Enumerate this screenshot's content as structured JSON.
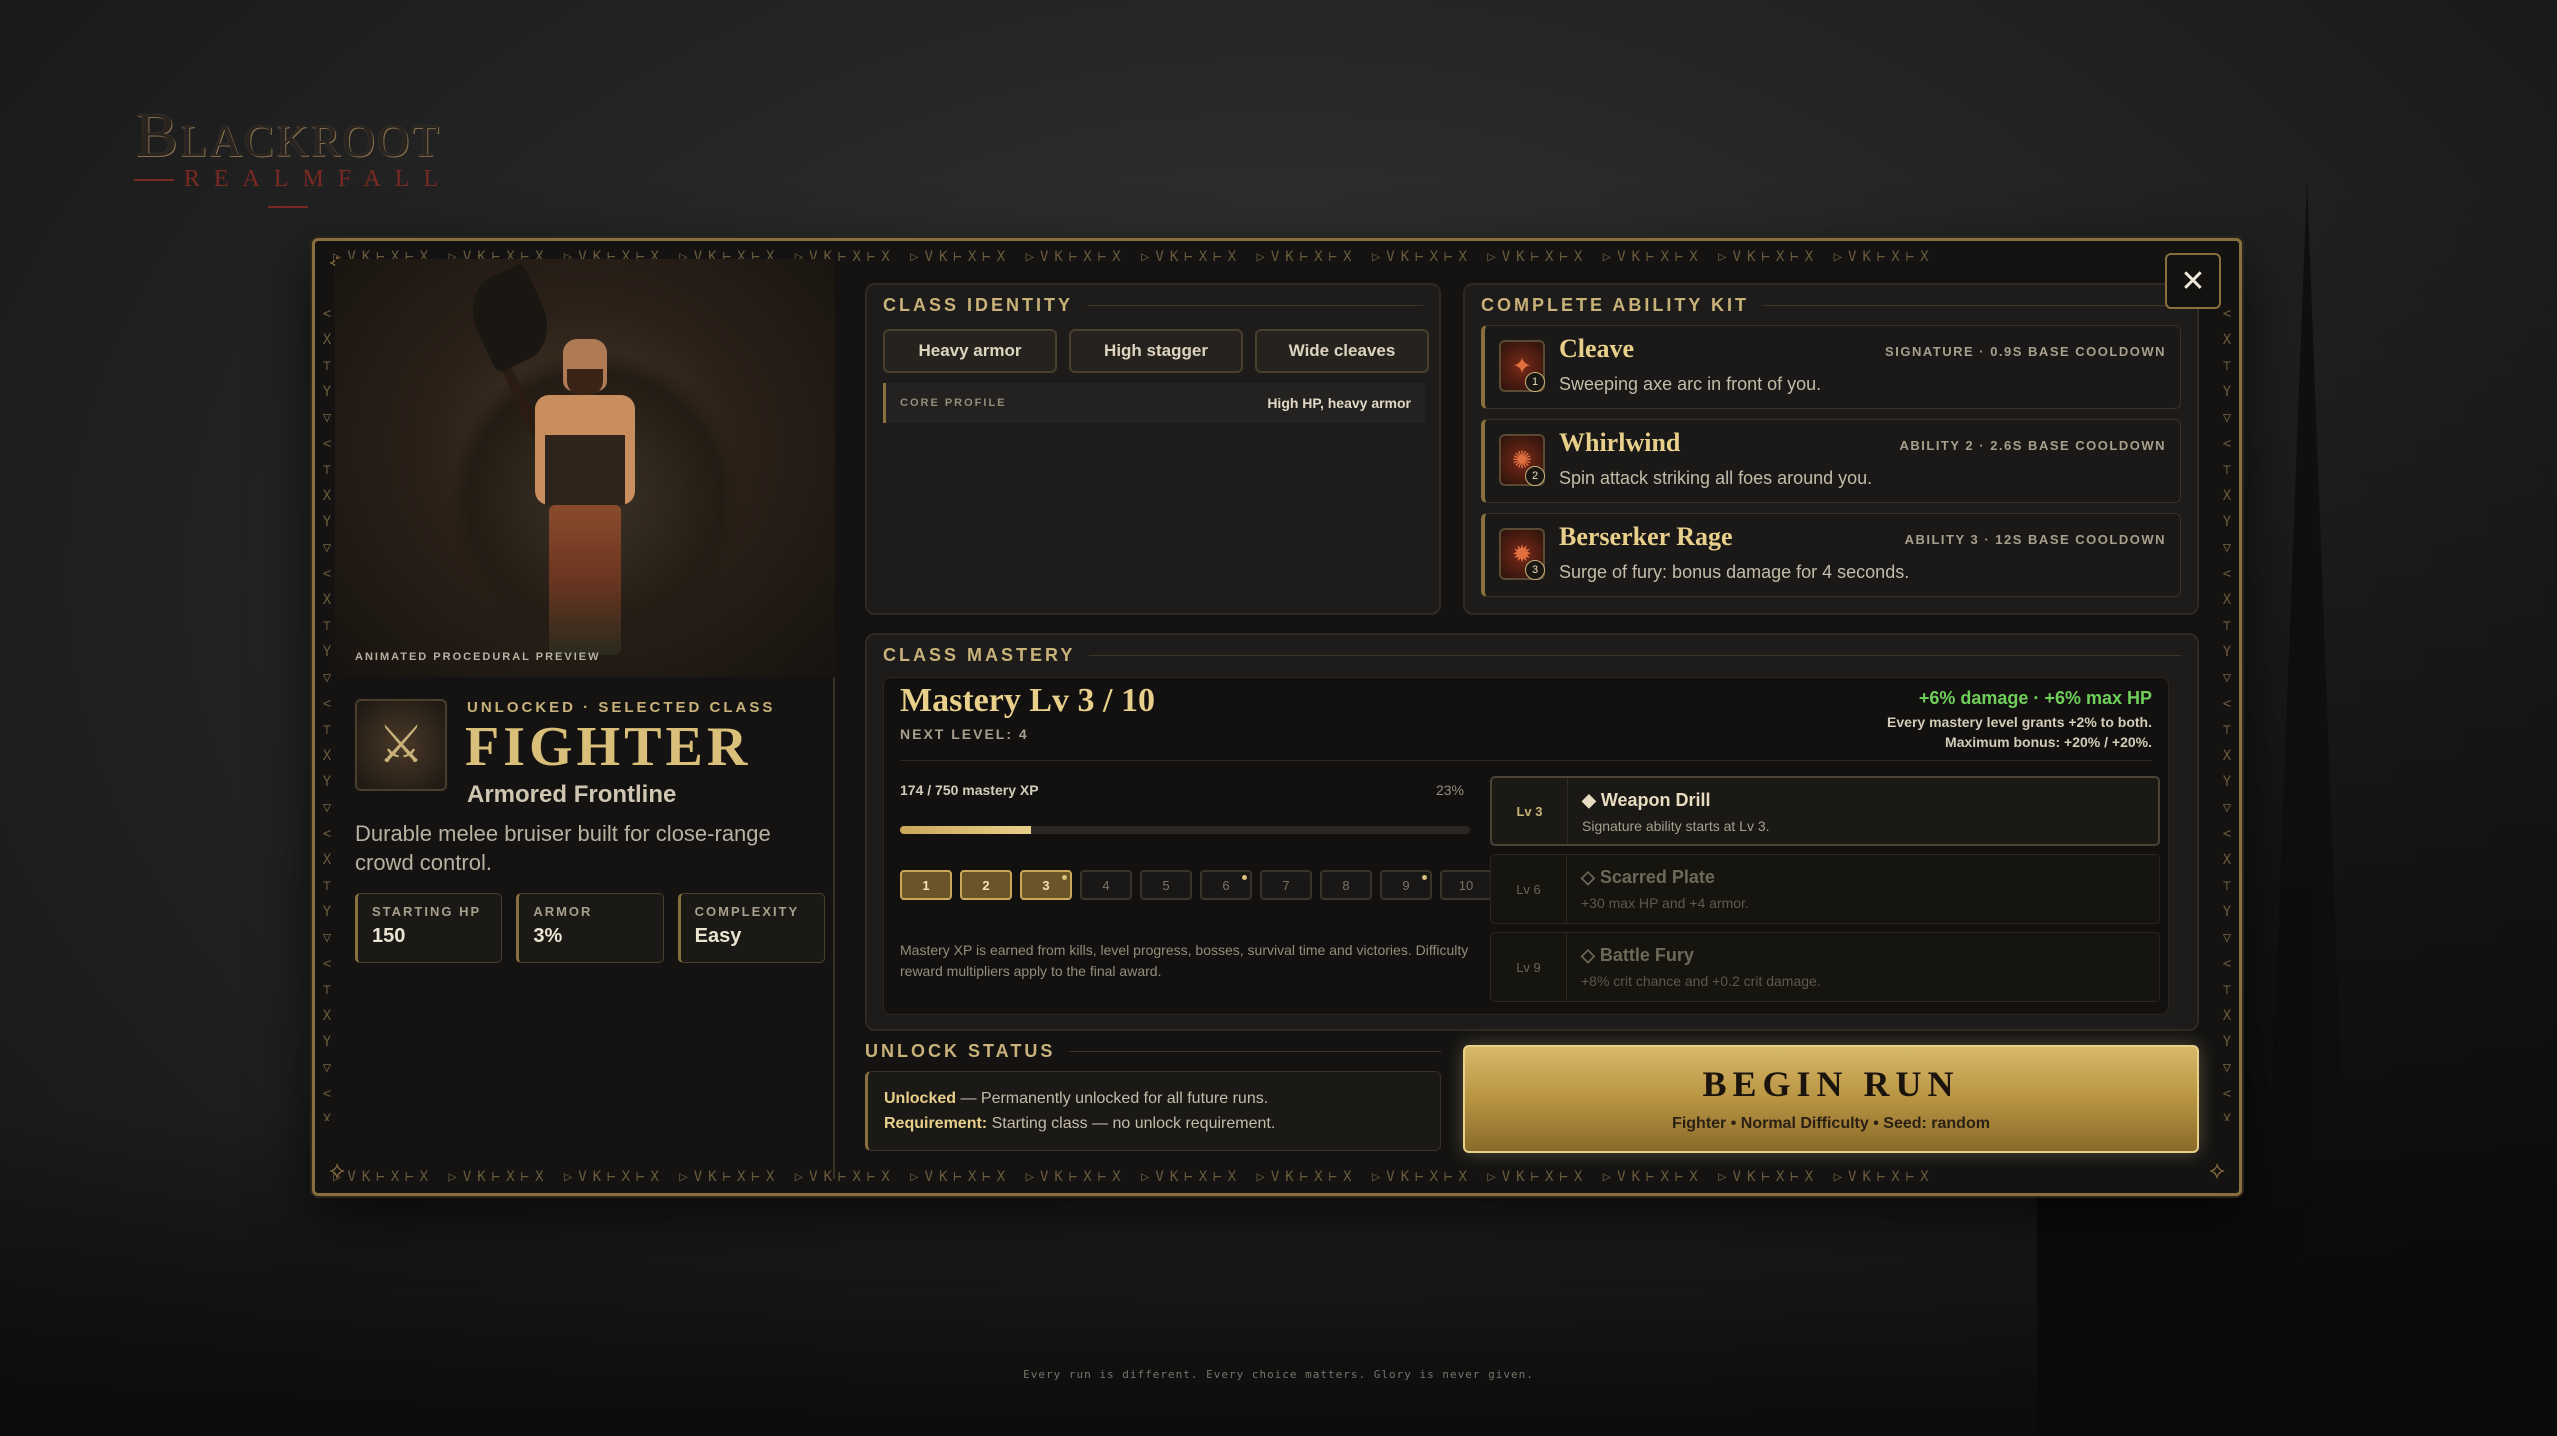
{
  "logo": {
    "main": "Blackroot",
    "sub": "REALMFALL"
  },
  "frame": {
    "runes": "▷VK⊢X⊢X ▷VK⊢X⊢X ▷VK⊢X⊢X ▷VK⊢X⊢X ▷VK⊢X⊢X ▷VK⊢X⊢X ▷VK⊢X⊢X ▷VK⊢X⊢X ▷VK⊢X⊢X ▷VK⊢X⊢X ▷VK⊢X⊢X ▷VK⊢X⊢X ▷VK⊢X⊢X ▷VK⊢X⊢X",
    "runes_v": "< X ⊤ Y ▽ < ⊤ X Y ▽ < X ⊤ Y ▽ < ⊤ X Y ▽ < X ⊤ Y ▽ < ⊤ X Y ▽ < X ⊤ Y ▽ < ⊤"
  },
  "preview": {
    "label": "ANIMATED PROCEDURAL PREVIEW"
  },
  "class": {
    "status_line": "UNLOCKED · SELECTED CLASS",
    "name": "FIGHTER",
    "role": "Armored Frontline",
    "description": "Durable melee bruiser built for close-range crowd control.",
    "stats": [
      {
        "label": "STARTING HP",
        "value": "150"
      },
      {
        "label": "ARMOR",
        "value": "3%"
      },
      {
        "label": "COMPLEXITY",
        "value": "Easy"
      }
    ]
  },
  "identity": {
    "title": "CLASS IDENTITY",
    "tags": [
      "Heavy armor",
      "High stagger",
      "Wide cleaves"
    ],
    "profile_label": "CORE PROFILE",
    "profile_value": "High HP, heavy armor"
  },
  "abilities": {
    "title": "COMPLETE ABILITY KIT",
    "items": [
      {
        "name": "Cleave",
        "desc": "Sweeping axe arc in front of you.",
        "meta": "SIGNATURE · 0.9S BASE COOLDOWN",
        "num": "1"
      },
      {
        "name": "Whirlwind",
        "desc": "Spin attack striking all foes around you.",
        "meta": "ABILITY 2 · 2.6S BASE COOLDOWN",
        "num": "2"
      },
      {
        "name": "Berserker Rage",
        "desc": "Surge of fury: bonus damage for 4 seconds.",
        "meta": "ABILITY 3 · 12S BASE COOLDOWN",
        "num": "3"
      }
    ]
  },
  "mastery": {
    "title": "CLASS MASTERY",
    "level_text": "Mastery Lv 3 / 10",
    "next_level": "NEXT LEVEL: 4",
    "bonus": "+6% damage · +6% max HP",
    "note1": "Every mastery level grants +2% to both.",
    "note2": "Maximum bonus: +20% / +20%.",
    "xp_label": "174 / 750 mastery XP",
    "xp_percent": "23%",
    "xp_fraction": 0.23,
    "levels": [
      "1",
      "2",
      "3",
      "4",
      "5",
      "6",
      "7",
      "8",
      "9",
      "10"
    ],
    "current_level": 3,
    "footnote": "Mastery XP is earned from kills, level progress, bosses, survival time and victories. Difficulty reward multipliers apply to the final award.",
    "unlocks": [
      {
        "lv": "Lv 3",
        "name": "◆ Weapon Drill",
        "desc": "Signature ability starts at Lv 3."
      },
      {
        "lv": "Lv 6",
        "name": "◇ Scarred Plate",
        "desc": "+30 max HP and +4 armor."
      },
      {
        "lv": "Lv 9",
        "name": "◇ Battle Fury",
        "desc": "+8% crit chance and +0.2 crit damage."
      }
    ]
  },
  "unlock_status": {
    "title": "UNLOCK STATUS",
    "line1_bold": "Unlocked",
    "line1_rest": " — Permanently unlocked for all future runs.",
    "line2_bold": "Requirement:",
    "line2_rest": " Starting class — no unlock requirement."
  },
  "begin": {
    "label": "BEGIN RUN",
    "sub": "Fighter • Normal Difficulty • Seed: random"
  },
  "close": {
    "label": "✕"
  },
  "tagline": "Every run is different. Every choice matters. Glory is never given.",
  "colors": {
    "gold": "#c9b27a",
    "gold_bright": "#e8cf8a",
    "green_bonus": "#6fcf5a",
    "panel_bg": "#1d1c1a"
  }
}
